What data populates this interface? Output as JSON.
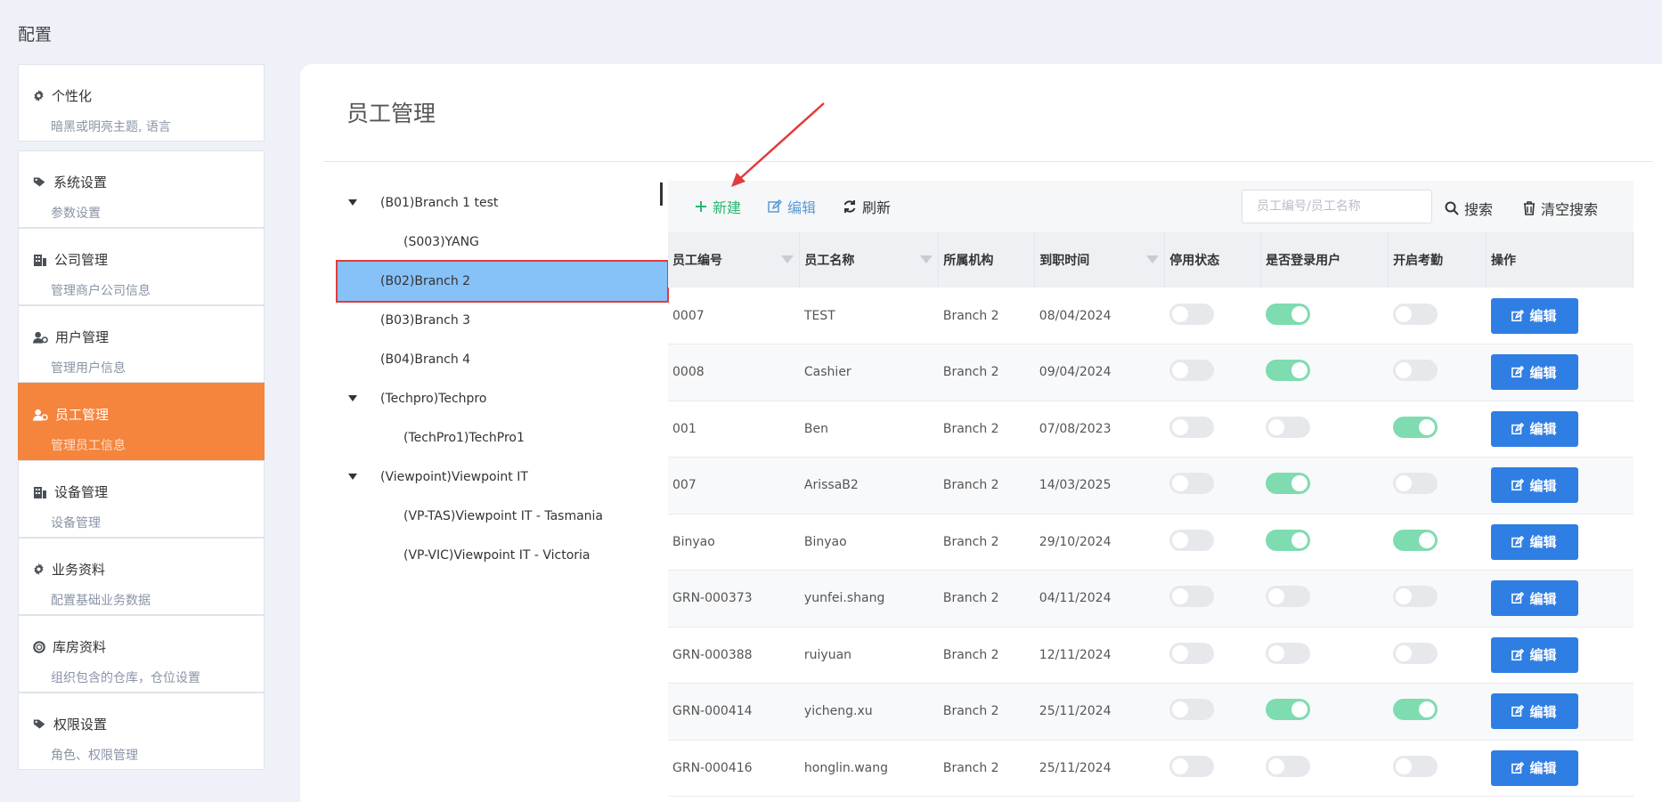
{
  "page": {
    "title": "配置"
  },
  "sidebar": {
    "items": [
      {
        "icon": "gear-icon",
        "label": "个性化",
        "sub": "暗黑或明亮主题, 语言"
      },
      {
        "icon": "tags-icon",
        "label": "系统设置",
        "sub": "参数设置"
      },
      {
        "icon": "building-icon",
        "label": "公司管理",
        "sub": "管理商户公司信息"
      },
      {
        "icon": "user-gear-icon",
        "label": "用户管理",
        "sub": "管理用户信息"
      },
      {
        "icon": "user-gear-icon",
        "label": "员工管理",
        "sub": "管理员工信息"
      },
      {
        "icon": "building-icon",
        "label": "设备管理",
        "sub": "设备管理"
      },
      {
        "icon": "gear-icon",
        "label": "业务资料",
        "sub": "配置基础业务数据"
      },
      {
        "icon": "lifebuoy-icon",
        "label": "库房资料",
        "sub": "组织包含的仓库，仓位设置"
      },
      {
        "icon": "tags-icon",
        "label": "权限设置",
        "sub": "角色、权限管理"
      }
    ]
  },
  "main": {
    "title": "员工管理"
  },
  "tree": {
    "nodes": [
      {
        "label": "(B01)Branch 1 test",
        "level": 1,
        "expanded": true
      },
      {
        "label": "(S003)YANG",
        "level": 2
      },
      {
        "label": "(B02)Branch 2",
        "level": 1,
        "selected": true
      },
      {
        "label": "(B03)Branch 3",
        "level": 1
      },
      {
        "label": "(B04)Branch 4",
        "level": 1
      },
      {
        "label": "(Techpro)Techpro",
        "level": 1,
        "expanded": true
      },
      {
        "label": "(TechPro1)TechPro1",
        "level": 2
      },
      {
        "label": "(Viewpoint)Viewpoint IT",
        "level": 1,
        "expanded": true
      },
      {
        "label": "(VP-TAS)Viewpoint IT - Tasmania",
        "level": 2
      },
      {
        "label": "(VP-VIC)Viewpoint IT - Victoria",
        "level": 2
      }
    ]
  },
  "toolbar": {
    "new_label": "新建",
    "edit_label": "编辑",
    "refresh_label": "刷新",
    "search_placeholder": "员工编号/员工名称",
    "search_label": "搜索",
    "clear_label": "清空搜索"
  },
  "table": {
    "headers": [
      "员工编号",
      "员工名称",
      "所属机构",
      "到职时间",
      "停用状态",
      "是否登录用户",
      "开启考勤",
      "操作"
    ],
    "edit_label": "编辑",
    "rows": [
      {
        "code": "0007",
        "name": "TEST",
        "org": "Branch 2",
        "date": "08/04/2024",
        "disabled": false,
        "login": true,
        "attendance": false
      },
      {
        "code": "0008",
        "name": "Cashier",
        "org": "Branch 2",
        "date": "09/04/2024",
        "disabled": false,
        "login": true,
        "attendance": false
      },
      {
        "code": "001",
        "name": "Ben",
        "org": "Branch 2",
        "date": "07/08/2023",
        "disabled": false,
        "login": false,
        "attendance": true
      },
      {
        "code": "007",
        "name": "ArissaB2",
        "org": "Branch 2",
        "date": "14/03/2025",
        "disabled": false,
        "login": true,
        "attendance": false
      },
      {
        "code": "Binyao",
        "name": "Binyao",
        "org": "Branch 2",
        "date": "29/10/2024",
        "disabled": false,
        "login": true,
        "attendance": true
      },
      {
        "code": "GRN-000373",
        "name": "yunfei.shang",
        "org": "Branch 2",
        "date": "04/11/2024",
        "disabled": false,
        "login": false,
        "attendance": false
      },
      {
        "code": "GRN-000388",
        "name": "ruiyuan",
        "org": "Branch 2",
        "date": "12/11/2024",
        "disabled": false,
        "login": false,
        "attendance": false
      },
      {
        "code": "GRN-000414",
        "name": "yicheng.xu",
        "org": "Branch 2",
        "date": "25/11/2024",
        "disabled": false,
        "login": true,
        "attendance": true
      },
      {
        "code": "GRN-000416",
        "name": "honglin.wang",
        "org": "Branch 2",
        "date": "25/11/2024",
        "disabled": false,
        "login": false,
        "attendance": false
      }
    ]
  },
  "colors": {
    "accent": "#f5843d",
    "primary": "#2f7ee3",
    "success": "#2bb673",
    "toggle_on": "#7edcb0"
  }
}
